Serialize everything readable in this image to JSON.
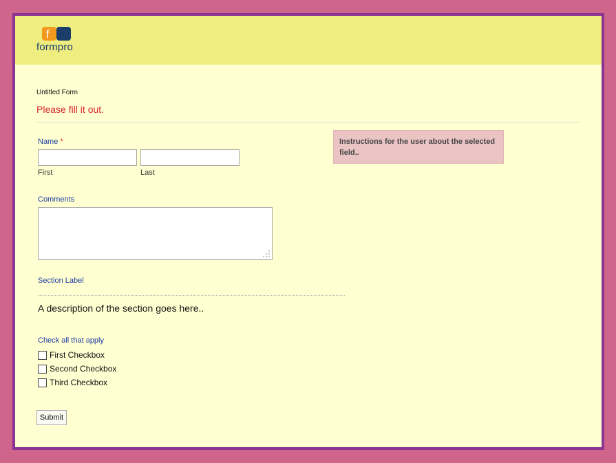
{
  "brand": {
    "logo_text": "formpro",
    "logo_letter": "f"
  },
  "colors": {
    "page_bg": "#cf658a",
    "frame_border": "#8b3494",
    "form_bg": "#ffffd2",
    "header_bg": "#efed80",
    "label_blue": "#1a3aa0",
    "error_red": "#d7282f",
    "instructions_bg": "#eac3c3",
    "logo_orange": "#f39a1e",
    "logo_navy": "#1a3e69"
  },
  "form": {
    "title": "Untitled Form",
    "description": "Please fill it out."
  },
  "name_field": {
    "label": "Name",
    "required_mark": "*",
    "first_value": "",
    "last_value": "",
    "first_sublabel": "First",
    "last_sublabel": "Last"
  },
  "instructions": {
    "text": "Instructions for the user about the selected field.."
  },
  "comments_field": {
    "label": "Comments",
    "value": ""
  },
  "section": {
    "label": "Section Label",
    "description": "A description of the section goes here.."
  },
  "checkbox_group": {
    "label": "Check all that apply",
    "options": [
      {
        "label": "First Checkbox",
        "checked": false
      },
      {
        "label": "Second Checkbox",
        "checked": false
      },
      {
        "label": "Third Checkbox",
        "checked": false
      }
    ]
  },
  "submit": {
    "label": "Submit"
  }
}
